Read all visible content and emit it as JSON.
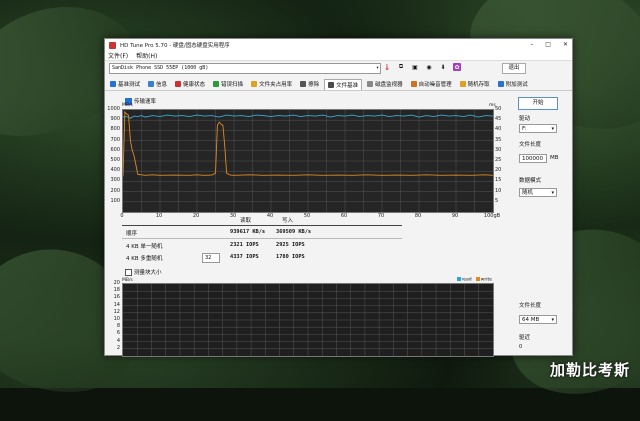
{
  "window": {
    "title": "HD Tune Pro 5.70 - 硬盘/固态硬盘实用程序",
    "minimize": "–",
    "maximize": "□",
    "close": "✕"
  },
  "menu": [
    "文件(F)",
    "帮助(H)"
  ],
  "toolbar": {
    "drive": "SanDisk Phone SSD 55EP (1000 gB)",
    "exit_label": "退出",
    "icons": [
      "thermometer-icon",
      "copy-icon",
      "save-icon",
      "camera-icon",
      "download-icon",
      "plugin-icon"
    ]
  },
  "tabs": [
    {
      "label": "基准测试",
      "color": "#2a6fd6"
    },
    {
      "label": "信息",
      "color": "#3a7fd0"
    },
    {
      "label": "健康状态",
      "color": "#d03030"
    },
    {
      "label": "错误扫描",
      "color": "#2a9a3a"
    },
    {
      "label": "文件夹占用率",
      "color": "#e0a020"
    },
    {
      "label": "擦除",
      "color": "#555555"
    },
    {
      "label": "文件基准",
      "color": "#4a4a4a"
    },
    {
      "label": "磁盘监视器",
      "color": "#888888"
    },
    {
      "label": "自动噪音管理",
      "color": "#d07020"
    },
    {
      "label": "随机存取",
      "color": "#e0a020"
    },
    {
      "label": "附加测试",
      "color": "#2a6fd6"
    }
  ],
  "active_tab": "文件基准",
  "transfer_checkbox": "传输速率",
  "chart_data": {
    "type": "line",
    "left_unit": "MB/s",
    "right_unit": "ms",
    "yticks_left": [
      1000,
      900,
      800,
      700,
      600,
      500,
      400,
      300,
      200,
      100
    ],
    "yticks_right": [
      50,
      45,
      40,
      35,
      30,
      25,
      20,
      15,
      10,
      5
    ],
    "xticks": [
      "0",
      "10",
      "20",
      "30",
      "40",
      "50",
      "60",
      "70",
      "80",
      "90",
      "100gB"
    ],
    "xlim": [
      0,
      100
    ],
    "ylim": [
      0,
      1000
    ],
    "series": [
      {
        "color": "#3aaad8",
        "x": [
          0,
          1,
          2,
          3,
          4,
          5,
          6,
          8,
          10,
          12,
          14,
          16,
          18,
          20,
          22,
          24,
          26,
          28,
          30,
          32,
          34,
          36,
          38,
          40,
          42,
          44,
          46,
          48,
          50,
          52,
          54,
          56,
          58,
          60,
          62,
          64,
          66,
          68,
          70,
          72,
          74,
          76,
          78,
          80,
          82,
          84,
          86,
          88,
          90,
          92,
          94,
          96,
          98,
          100
        ],
        "values": [
          930,
          935,
          920,
          940,
          935,
          945,
          930,
          945,
          935,
          950,
          940,
          945,
          935,
          950,
          940,
          945,
          930,
          950,
          940,
          945,
          935,
          950,
          945,
          935,
          945,
          940,
          950,
          935,
          945,
          940,
          950,
          930,
          945,
          940,
          950,
          935,
          945,
          940,
          950,
          935,
          945,
          940,
          950,
          930,
          945,
          935,
          950,
          940,
          945,
          935,
          950,
          930,
          945,
          940
        ]
      },
      {
        "color": "#e08a20",
        "x": [
          0,
          0.5,
          1,
          1.5,
          2,
          2.5,
          3,
          4,
          6,
          8,
          10,
          14,
          18,
          20,
          22,
          24,
          25,
          25.5,
          26,
          26.5,
          27,
          27.5,
          28,
          29,
          30,
          34,
          38,
          42,
          46,
          50,
          54,
          58,
          62,
          66,
          70,
          74,
          78,
          82,
          86,
          90,
          94,
          98,
          100
        ],
        "values": [
          350,
          980,
          960,
          950,
          700,
          600,
          550,
          370,
          360,
          365,
          360,
          362,
          360,
          365,
          360,
          362,
          380,
          850,
          880,
          860,
          850,
          640,
          380,
          362,
          360,
          365,
          360,
          362,
          360,
          365,
          360,
          362,
          360,
          365,
          360,
          362,
          360,
          365,
          360,
          362,
          360,
          365,
          360
        ]
      }
    ],
    "grid": true
  },
  "results": {
    "col_read": "读取",
    "col_write": "写入",
    "rows": [
      {
        "label": "顺序",
        "read": "939617 KB/s",
        "write": "369509 KB/s"
      },
      {
        "label": "4 KB 单一随机",
        "read": "2321 IOPS",
        "write": "2925 IOPS"
      },
      {
        "label": "4 KB 多重随机",
        "read": "4337 IOPS",
        "write": "1780 IOPS",
        "queue": "32"
      }
    ]
  },
  "block_checkbox": "测量块大小",
  "chart2": {
    "unit": "MB/s",
    "yticks": [
      20,
      18,
      16,
      14,
      12,
      10,
      8,
      6,
      4,
      2
    ],
    "legend_read": "read",
    "legend_write": "write"
  },
  "side": {
    "start_label": "开始",
    "drive_label": "驱动",
    "drive_value": "F:",
    "filelen_label": "文件长度",
    "filelen_value": "100000",
    "filelen_unit": "MB",
    "pattern_label": "数据模式",
    "pattern_value": "随机",
    "filelen2_label": "文件长度",
    "filelen2_value": "64 MB",
    "align_label": "驱近",
    "align_value": "0"
  },
  "watermark": "加勒比考斯"
}
